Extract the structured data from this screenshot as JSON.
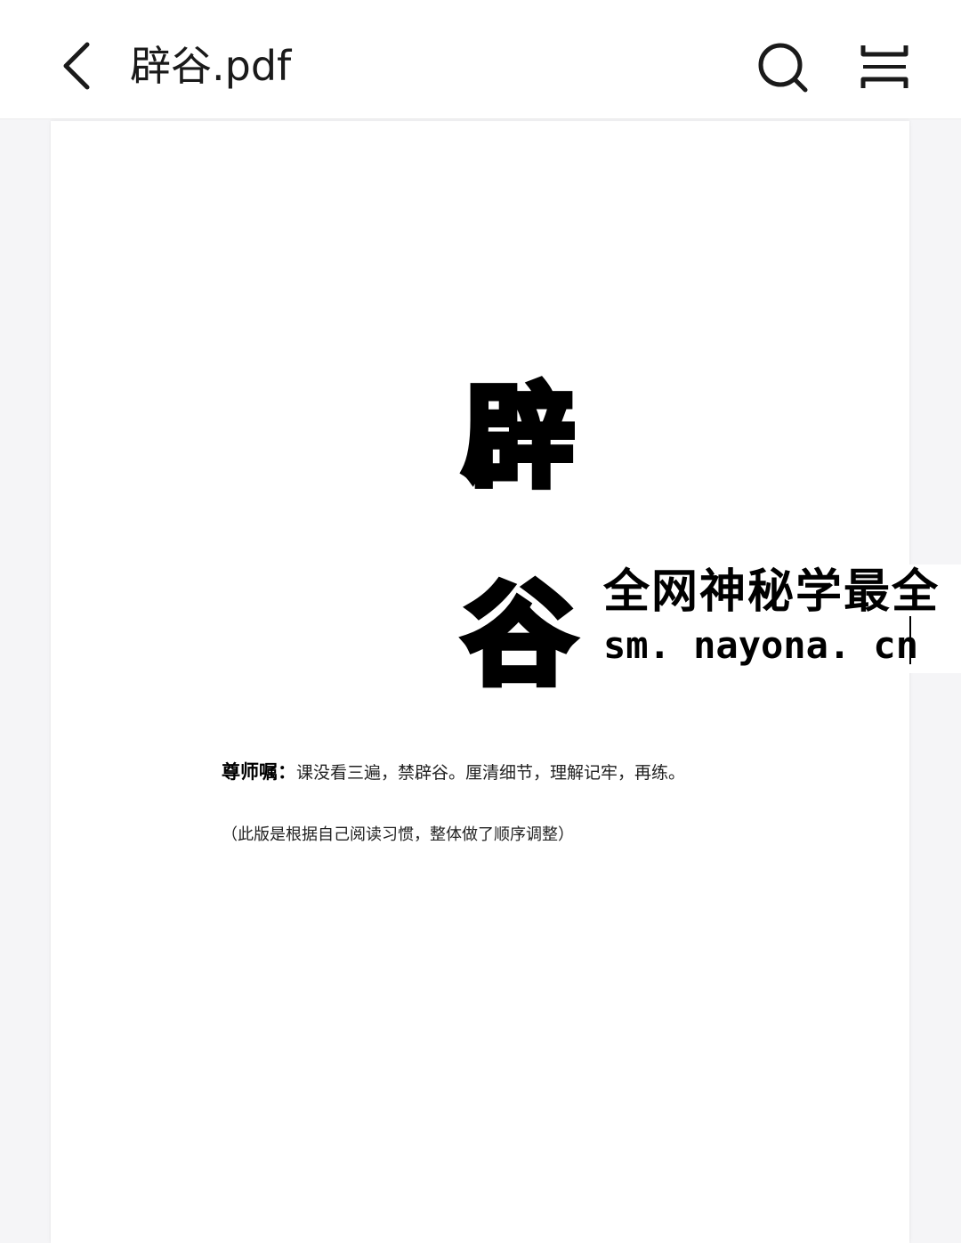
{
  "header": {
    "file_name": "辟谷.pdf",
    "back_icon": "chevron-left-icon",
    "search_icon": "search-icon",
    "menu_icon": "double-bracket-icon"
  },
  "document": {
    "cover_title_char_1": "辟",
    "cover_title_char_2": "谷",
    "motto_label": "尊师嘱：",
    "motto_text": "课没看三遍，禁辟谷。厘清细节，理解记牢，再练。",
    "note_text": "（此版是根据自己阅读习惯，整体做了顺序调整）"
  },
  "watermark": {
    "line1": "全网神秘学最全",
    "line2": "sm. nayona. cn"
  }
}
